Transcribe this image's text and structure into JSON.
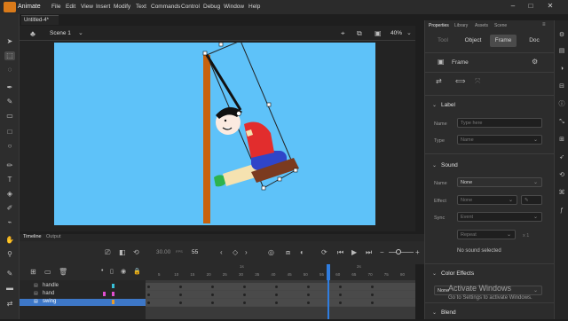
{
  "app": {
    "name": "Animate"
  },
  "menu": [
    "File",
    "Edit",
    "View",
    "Insert",
    "Modify",
    "Text",
    "Commands",
    "Control",
    "Debug",
    "Window",
    "Help"
  ],
  "document_tab": "Untitled-4*",
  "scene": {
    "label": "Scene 1",
    "zoom": "40%"
  },
  "timeline": {
    "tabs": [
      "Timeline",
      "Output"
    ],
    "fps": "30.00",
    "fps_unit": "FPS",
    "current_frame": "55",
    "ruler_top": [
      "1s",
      "2s"
    ],
    "ruler_numbers": [
      "5",
      "10",
      "15",
      "20",
      "25",
      "30",
      "35",
      "40",
      "45",
      "50",
      "55",
      "60",
      "65",
      "70",
      "75",
      "80"
    ],
    "layers": [
      {
        "name": "handle",
        "selected": false
      },
      {
        "name": "hand",
        "selected": false
      },
      {
        "name": "swing",
        "selected": true
      }
    ]
  },
  "panel": {
    "tabs": [
      "Properties",
      "Library",
      "Assets",
      "Scene"
    ],
    "segments": [
      "Tool",
      "Object",
      "Frame",
      "Doc"
    ],
    "active_segment": "Frame",
    "frame_label": "Frame",
    "label_section": {
      "title": "Label",
      "name_label": "Name",
      "name_placeholder": "Type here",
      "type_label": "Type",
      "type_value": "Name"
    },
    "sound_section": {
      "title": "Sound",
      "name_label": "Name",
      "name_value": "None",
      "effect_label": "Effect",
      "effect_value": "None",
      "sync_label": "Sync",
      "sync_value": "Event",
      "repeat_value": "Repeat",
      "repeat_count": "x 1",
      "status": "No sound selected"
    },
    "color_effects": {
      "title": "Color Effects",
      "value": "None"
    },
    "blend": {
      "title": "Blend"
    }
  },
  "watermark": {
    "title": "Activate Windows",
    "subtitle": "Go to Settings to activate Windows."
  },
  "colors": {
    "stage": "#5ec2f9",
    "pole": "#c8620d",
    "accent_orange": "#d97a1a",
    "selection_blue": "#3d77c7",
    "playhead": "#2f7de0"
  }
}
